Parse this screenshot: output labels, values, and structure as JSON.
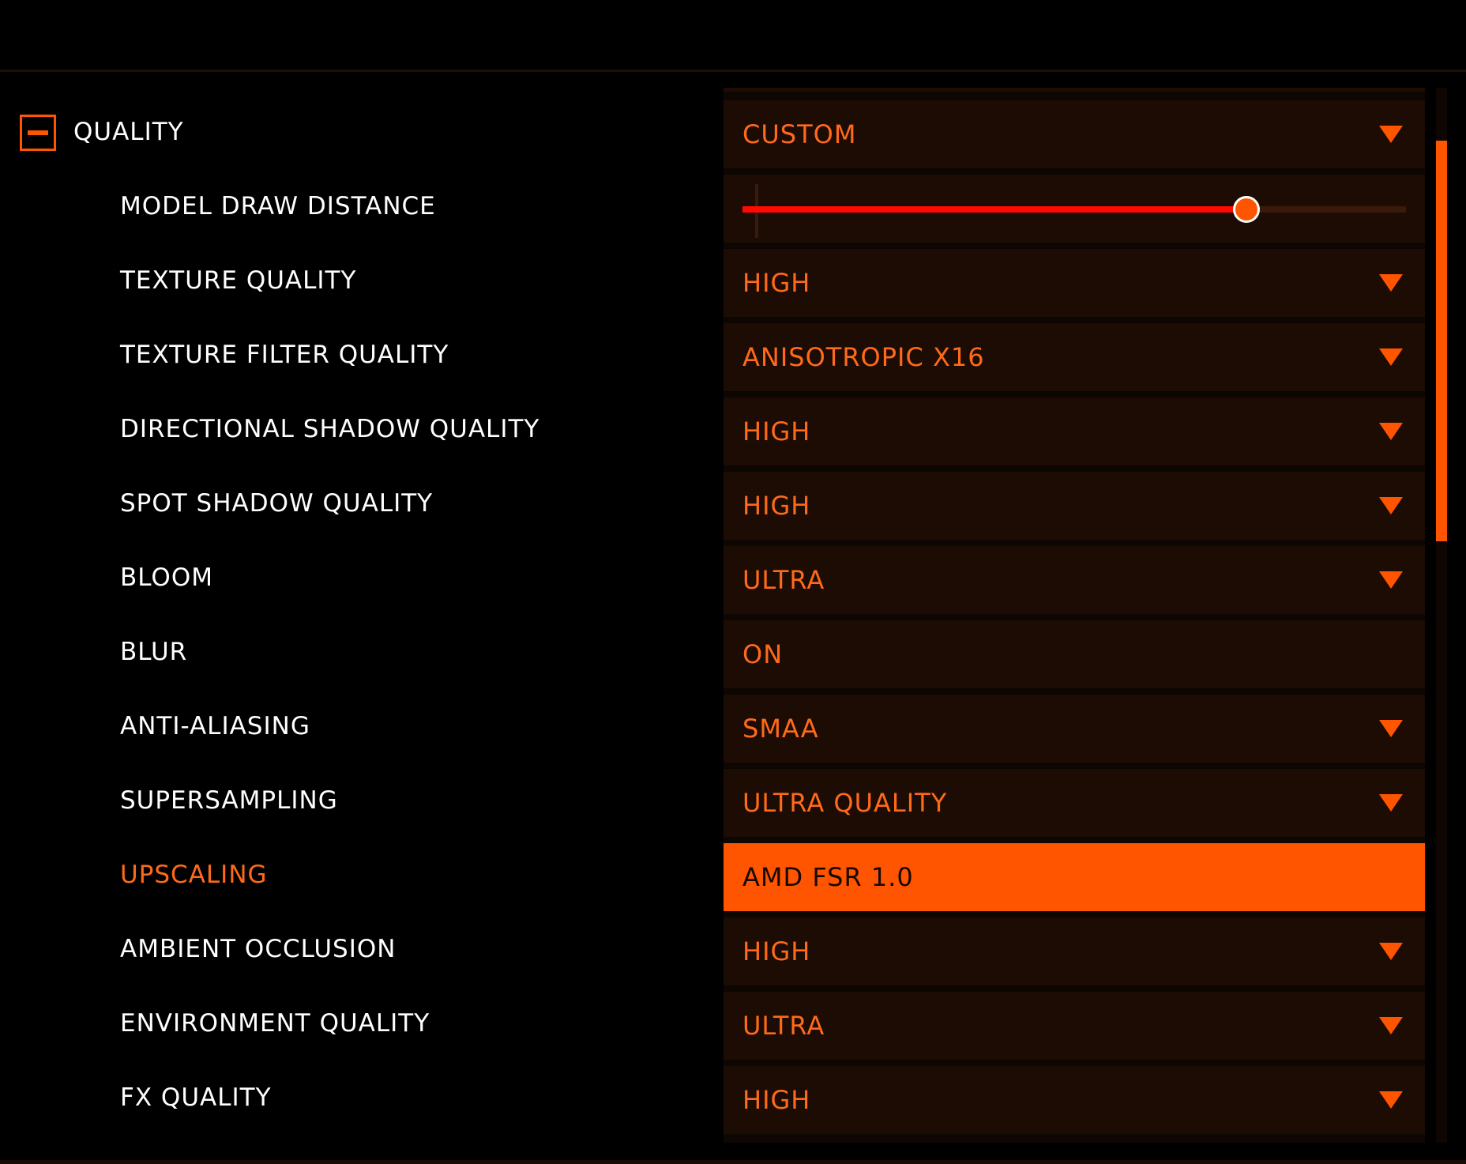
{
  "section": {
    "title": "QUALITY",
    "preset": "CUSTOM",
    "collapse_icon": "minus-square-icon"
  },
  "slider": {
    "label": "MODEL DRAW DISTANCE",
    "value_fraction": 0.76
  },
  "settings": [
    {
      "label": "TEXTURE QUALITY",
      "value": "HIGH",
      "dropdown": true
    },
    {
      "label": "TEXTURE FILTER QUALITY",
      "value": "ANISOTROPIC X16",
      "dropdown": true
    },
    {
      "label": "DIRECTIONAL SHADOW QUALITY",
      "value": "HIGH",
      "dropdown": true
    },
    {
      "label": "SPOT SHADOW QUALITY",
      "value": "HIGH",
      "dropdown": true
    },
    {
      "label": "BLOOM",
      "value": "ULTRA",
      "dropdown": true
    },
    {
      "label": "BLUR",
      "value": "ON",
      "dropdown": false
    },
    {
      "label": "ANTI-ALIASING",
      "value": "SMAA",
      "dropdown": true
    },
    {
      "label": "SUPERSAMPLING",
      "value": "ULTRA QUALITY",
      "dropdown": true
    },
    {
      "label": "UPSCALING",
      "value": "AMD FSR 1.0",
      "dropdown": false,
      "selected": true
    },
    {
      "label": "AMBIENT OCCLUSION",
      "value": "HIGH",
      "dropdown": true
    },
    {
      "label": "ENVIRONMENT QUALITY",
      "value": "ULTRA",
      "dropdown": true
    },
    {
      "label": "FX QUALITY",
      "value": "HIGH",
      "dropdown": true
    }
  ],
  "colors": {
    "accent": "#ff5500",
    "text_accent": "#ff6a1a",
    "control_bg": "#1c0c03",
    "slider_fill": "#ff0a00",
    "label": "#ffffff"
  },
  "scrollbar": {
    "position_fraction": 0.05,
    "visible_fraction": 0.38
  }
}
